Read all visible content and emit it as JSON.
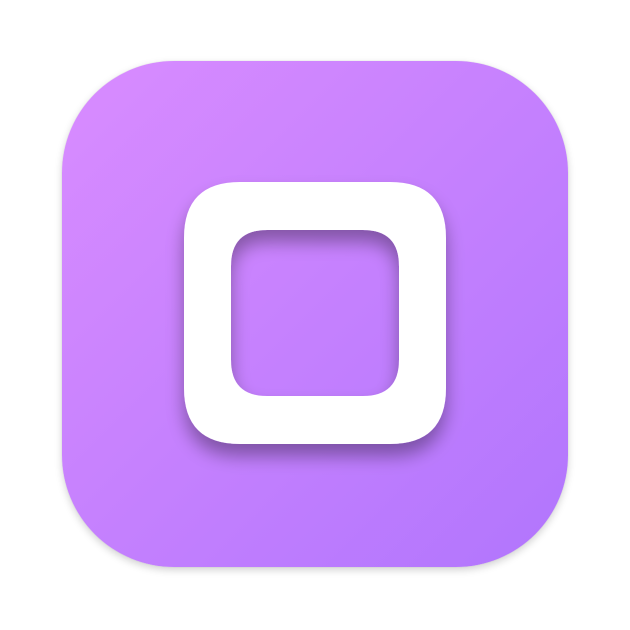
{
  "icon": {
    "name": "rounded-square-app-icon",
    "colors": {
      "gradient_start": "#d98cff",
      "gradient_end": "#b175fd",
      "glyph": "#ffffff"
    }
  }
}
